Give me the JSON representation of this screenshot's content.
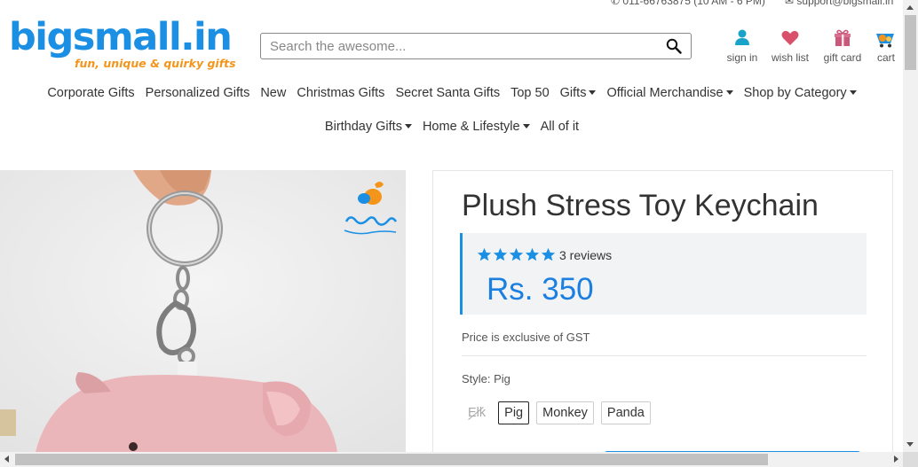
{
  "topbar": {
    "phone": "011-66763875 (10 AM - 6 PM)",
    "email": "support@bigsmall.in"
  },
  "logo": {
    "name": "bigsmall.in",
    "tagline": "fun, unique & quirky gifts"
  },
  "search": {
    "placeholder": "Search the awesome..."
  },
  "header_actions": [
    {
      "label": "sign in",
      "icon": "user-icon"
    },
    {
      "label": "wish list",
      "icon": "heart-icon"
    },
    {
      "label": "gift card",
      "icon": "gift-icon"
    },
    {
      "label": "cart",
      "icon": "cart-icon"
    }
  ],
  "nav": {
    "row1": [
      {
        "label": "Corporate Gifts",
        "dropdown": false
      },
      {
        "label": "Personalized Gifts",
        "dropdown": false
      },
      {
        "label": "New",
        "dropdown": false
      },
      {
        "label": "Christmas Gifts",
        "dropdown": false
      },
      {
        "label": "Secret Santa Gifts",
        "dropdown": false
      },
      {
        "label": "Top 50",
        "dropdown": false
      },
      {
        "label": "Gifts",
        "dropdown": true
      },
      {
        "label": "Official Merchandise",
        "dropdown": true
      },
      {
        "label": "Shop by Category",
        "dropdown": true
      }
    ],
    "row2": [
      {
        "label": "Birthday Gifts",
        "dropdown": true
      },
      {
        "label": "Home & Lifestyle",
        "dropdown": true
      },
      {
        "label": "All of it",
        "dropdown": false
      }
    ]
  },
  "product": {
    "title": "Plush Stress Toy Keychain",
    "rating": 5,
    "reviews": "3 reviews",
    "price": "Rs. 350",
    "gst_note": "Price is exclusive of GST",
    "style_label": "Style: Pig",
    "styles": [
      {
        "label": "Elk",
        "state": "disabled"
      },
      {
        "label": "Pig",
        "state": "selected"
      },
      {
        "label": "Monkey",
        "state": "available"
      },
      {
        "label": "Panda",
        "state": "available"
      }
    ]
  },
  "colors": {
    "brand_blue": "#1a8fe3",
    "brand_orange": "#f4951b",
    "star_blue": "#1a8fe3",
    "price_blue": "#1a7fe0"
  }
}
